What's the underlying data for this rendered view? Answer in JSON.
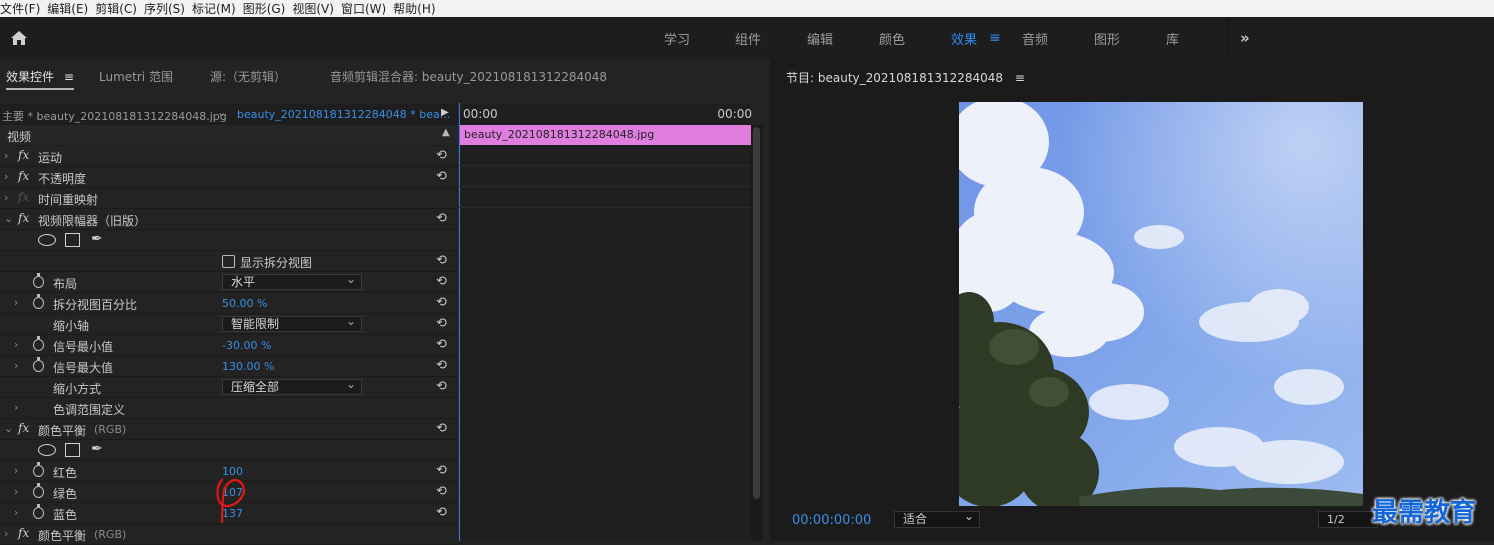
{
  "menu": [
    "文件(F)",
    "编辑(E)",
    "剪辑(C)",
    "序列(S)",
    "标记(M)",
    "图形(G)",
    "视图(V)",
    "窗口(W)",
    "帮助(H)"
  ],
  "workspaces": {
    "learn": "学习",
    "assembly": "组件",
    "editing": "编辑",
    "color": "颜色",
    "effects": "效果",
    "audio": "音频",
    "graphics": "图形",
    "libraries": "库",
    "more": "»"
  },
  "tabs": {
    "effect_controls": "效果控件",
    "lumetri_scopes": "Lumetri 范围",
    "source": "源:（无剪辑）",
    "audio_mixer": "音频剪辑混合器: beauty_202108181312284048",
    "menu_icon": "≡"
  },
  "source_bar": {
    "master": "主要 * beauty_202108181312284048.jpg",
    "clip": "beauty_202108181312284048 * bea...",
    "tc_start": "00:00",
    "tc_end": "00:00"
  },
  "timeline": {
    "clip_name": "beauty_202108181312284048.jpg"
  },
  "effects": {
    "video_header": "视频",
    "motion": "运动",
    "opacity": "不透明度",
    "time_remap": "时间重映射",
    "video_limiter": "视频限幅器（旧版）",
    "show_split_view": "显示拆分视图",
    "layout_label": "布局",
    "layout_value": "水平",
    "split_percent_label": "拆分视图百分比",
    "split_percent_value": "50.00 %",
    "reduce_axis_label": "缩小轴",
    "reduce_axis_value": "智能限制",
    "signal_min_label": "信号最小值",
    "signal_min_value": "-30.00 %",
    "signal_max_label": "信号最大值",
    "signal_max_value": "130.00 %",
    "reduce_method_label": "缩小方式",
    "reduce_method_value": "压缩全部",
    "tonal_range_label": "色调范围定义",
    "color_balance": "颜色平衡",
    "rgb_suffix": "(RGB)",
    "red_label": "红色",
    "red_value": "100",
    "green_label": "绿色",
    "green_value": "107",
    "blue_label": "蓝色",
    "blue_value": "137",
    "color_balance_2": "颜色平衡"
  },
  "program": {
    "title": "节目: beauty_202108181312284048",
    "menu_icon": "≡",
    "timecode": "00:00:00:00",
    "fit": "适合",
    "resolution": "1/2"
  },
  "watermark": "最需教育"
}
